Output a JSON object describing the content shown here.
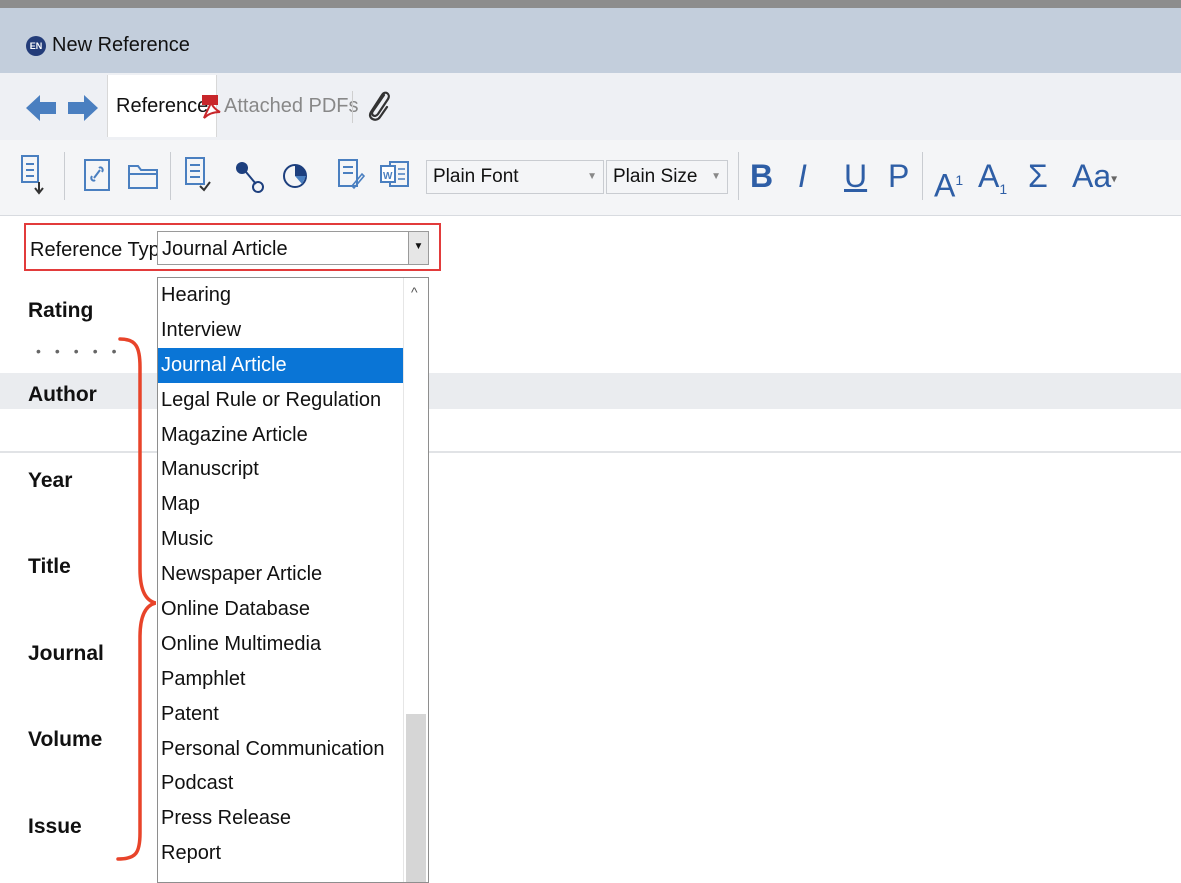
{
  "window": {
    "title": "New Reference",
    "app_icon_text": "EN"
  },
  "tabs": {
    "reference_label": "Reference",
    "attached_pdfs_label": "Attached PDFs"
  },
  "toolbar": {
    "font_value": "Plain Font",
    "size_value": "Plain Size",
    "bold": "B",
    "italic": "I",
    "underline": "U",
    "plain": "P",
    "superscript": "A",
    "superscript_mark": "1",
    "subscript": "A",
    "subscript_mark": "1",
    "symbol": "Σ",
    "case": "Aa"
  },
  "reference_type": {
    "label": "Reference Type:",
    "value": "Journal Article"
  },
  "fields": {
    "rating": "Rating",
    "author": "Author",
    "year": "Year",
    "title": "Title",
    "journal": "Journal",
    "volume": "Volume",
    "issue": "Issue"
  },
  "dropdown_items": [
    "Hearing",
    "Interview",
    "Journal Article",
    "Legal Rule or Regulation",
    "Magazine Article",
    "Manuscript",
    "Map",
    "Music",
    "Newspaper Article",
    "Online Database",
    "Online Multimedia",
    "Pamphlet",
    "Patent",
    "Personal Communication",
    "Podcast",
    "Press Release",
    "Report"
  ],
  "selected_item": "Journal Article",
  "colors": {
    "selection": "#0a75d6",
    "highlight_box": "#e23b3b",
    "annotation_brace": "#e8442a",
    "format_blue": "#2e5ea6"
  }
}
